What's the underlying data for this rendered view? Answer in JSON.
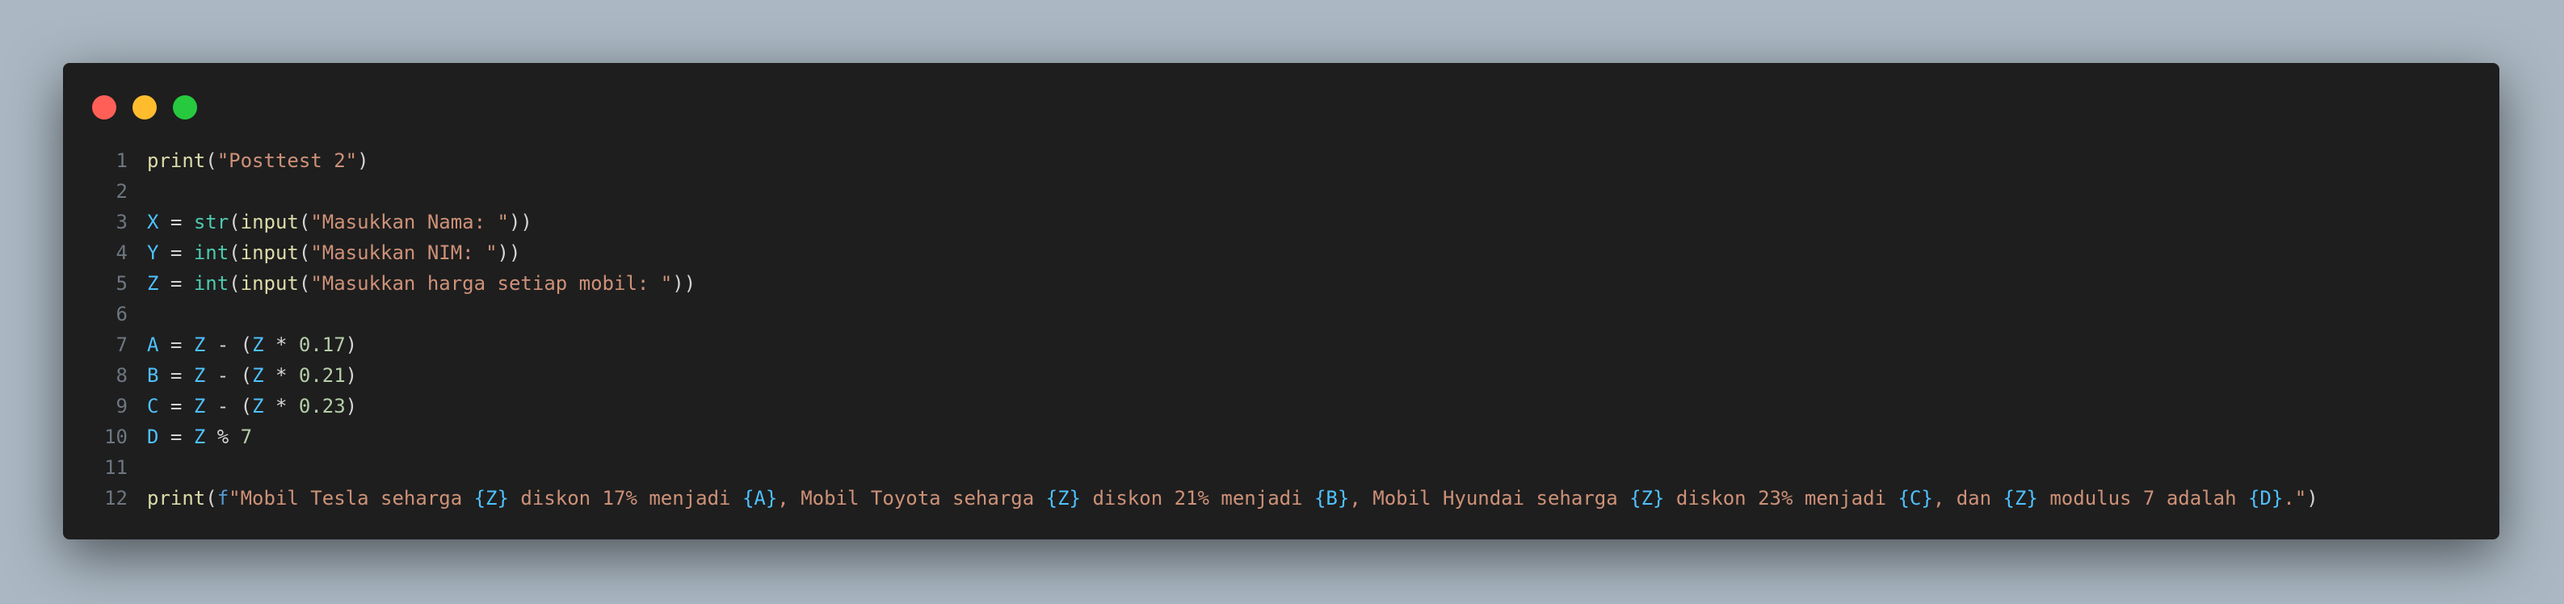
{
  "window": {
    "controls": [
      "close",
      "minimize",
      "maximize"
    ]
  },
  "code": {
    "lines": [
      {
        "no": "1",
        "tokens": [
          {
            "t": "print",
            "k": "fn"
          },
          {
            "t": "(",
            "k": "p"
          },
          {
            "t": "\"Posttest 2\"",
            "k": "str"
          },
          {
            "t": ")",
            "k": "p"
          }
        ]
      },
      {
        "no": "2",
        "tokens": []
      },
      {
        "no": "3",
        "tokens": [
          {
            "t": "X",
            "k": "var"
          },
          {
            "t": " = ",
            "k": "op"
          },
          {
            "t": "str",
            "k": "builtin"
          },
          {
            "t": "(",
            "k": "p"
          },
          {
            "t": "input",
            "k": "fn"
          },
          {
            "t": "(",
            "k": "p"
          },
          {
            "t": "\"Masukkan Nama: \"",
            "k": "str"
          },
          {
            "t": "))",
            "k": "p"
          }
        ]
      },
      {
        "no": "4",
        "tokens": [
          {
            "t": "Y",
            "k": "var"
          },
          {
            "t": " = ",
            "k": "op"
          },
          {
            "t": "int",
            "k": "builtin"
          },
          {
            "t": "(",
            "k": "p"
          },
          {
            "t": "input",
            "k": "fn"
          },
          {
            "t": "(",
            "k": "p"
          },
          {
            "t": "\"Masukkan NIM: \"",
            "k": "str"
          },
          {
            "t": "))",
            "k": "p"
          }
        ]
      },
      {
        "no": "5",
        "tokens": [
          {
            "t": "Z",
            "k": "var"
          },
          {
            "t": " = ",
            "k": "op"
          },
          {
            "t": "int",
            "k": "builtin"
          },
          {
            "t": "(",
            "k": "p"
          },
          {
            "t": "input",
            "k": "fn"
          },
          {
            "t": "(",
            "k": "p"
          },
          {
            "t": "\"Masukkan harga setiap mobil: \"",
            "k": "str"
          },
          {
            "t": "))",
            "k": "p"
          }
        ]
      },
      {
        "no": "6",
        "tokens": []
      },
      {
        "no": "7",
        "tokens": [
          {
            "t": "A",
            "k": "var"
          },
          {
            "t": " = ",
            "k": "op"
          },
          {
            "t": "Z",
            "k": "var"
          },
          {
            "t": " - (",
            "k": "op"
          },
          {
            "t": "Z",
            "k": "var"
          },
          {
            "t": " * ",
            "k": "op"
          },
          {
            "t": "0.17",
            "k": "num"
          },
          {
            "t": ")",
            "k": "p"
          }
        ]
      },
      {
        "no": "8",
        "tokens": [
          {
            "t": "B",
            "k": "var"
          },
          {
            "t": " = ",
            "k": "op"
          },
          {
            "t": "Z",
            "k": "var"
          },
          {
            "t": " - (",
            "k": "op"
          },
          {
            "t": "Z",
            "k": "var"
          },
          {
            "t": " * ",
            "k": "op"
          },
          {
            "t": "0.21",
            "k": "num"
          },
          {
            "t": ")",
            "k": "p"
          }
        ]
      },
      {
        "no": "9",
        "tokens": [
          {
            "t": "C",
            "k": "var"
          },
          {
            "t": " = ",
            "k": "op"
          },
          {
            "t": "Z",
            "k": "var"
          },
          {
            "t": " - (",
            "k": "op"
          },
          {
            "t": "Z",
            "k": "var"
          },
          {
            "t": " * ",
            "k": "op"
          },
          {
            "t": "0.23",
            "k": "num"
          },
          {
            "t": ")",
            "k": "p"
          }
        ]
      },
      {
        "no": "10",
        "tokens": [
          {
            "t": "D",
            "k": "var"
          },
          {
            "t": " = ",
            "k": "op"
          },
          {
            "t": "Z",
            "k": "var"
          },
          {
            "t": " % ",
            "k": "op"
          },
          {
            "t": "7",
            "k": "num"
          }
        ]
      },
      {
        "no": "11",
        "tokens": []
      },
      {
        "no": "12",
        "tokens": [
          {
            "t": "print",
            "k": "fn"
          },
          {
            "t": "(",
            "k": "p"
          },
          {
            "t": "f",
            "k": "kw"
          },
          {
            "t": "\"Mobil Tesla seharga ",
            "k": "str"
          },
          {
            "t": "{Z}",
            "k": "var"
          },
          {
            "t": " diskon 17% menjadi ",
            "k": "str"
          },
          {
            "t": "{A}",
            "k": "var"
          },
          {
            "t": ", Mobil Toyota seharga ",
            "k": "str"
          },
          {
            "t": "{Z}",
            "k": "var"
          },
          {
            "t": " diskon 21% menjadi ",
            "k": "str"
          },
          {
            "t": "{B}",
            "k": "var"
          },
          {
            "t": ", Mobil Hyundai seharga ",
            "k": "str"
          },
          {
            "t": "{Z}",
            "k": "var"
          },
          {
            "t": " diskon 23% menjadi ",
            "k": "str"
          },
          {
            "t": "{C}",
            "k": "var"
          },
          {
            "t": ", dan ",
            "k": "str"
          },
          {
            "t": "{Z}",
            "k": "var"
          },
          {
            "t": " modulus 7 adalah ",
            "k": "str"
          },
          {
            "t": "{D}",
            "k": "var"
          },
          {
            "t": ".\"",
            "k": "str"
          },
          {
            "t": ")",
            "k": "p"
          }
        ]
      }
    ]
  }
}
